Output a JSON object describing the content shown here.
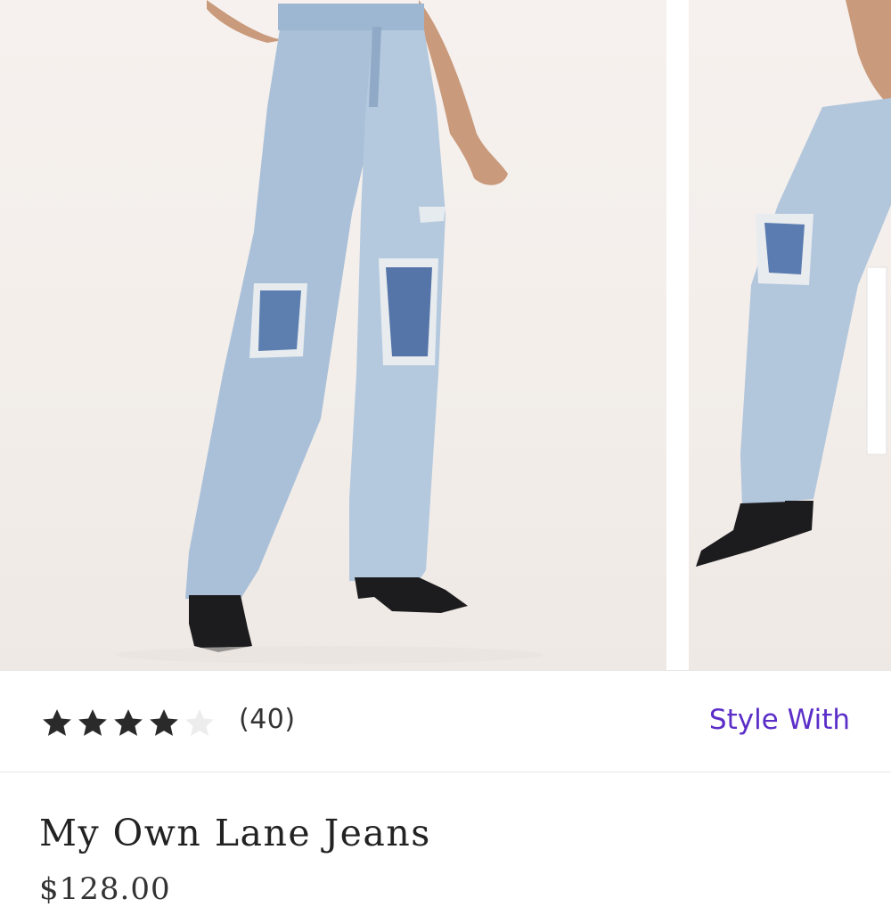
{
  "product": {
    "title": "My Own Lane Jeans",
    "price": "$128.00",
    "rating": 4,
    "rating_max": 5,
    "review_count": "(40)"
  },
  "actions": {
    "style_with_label": "Style With"
  },
  "colors": {
    "accent": "#5b2ec8",
    "star_filled": "#2a2a2a",
    "star_empty": "#ededed",
    "denim": "#a9c0d8",
    "boot": "#1c1c1e"
  },
  "icons": {
    "star": "star-icon"
  }
}
